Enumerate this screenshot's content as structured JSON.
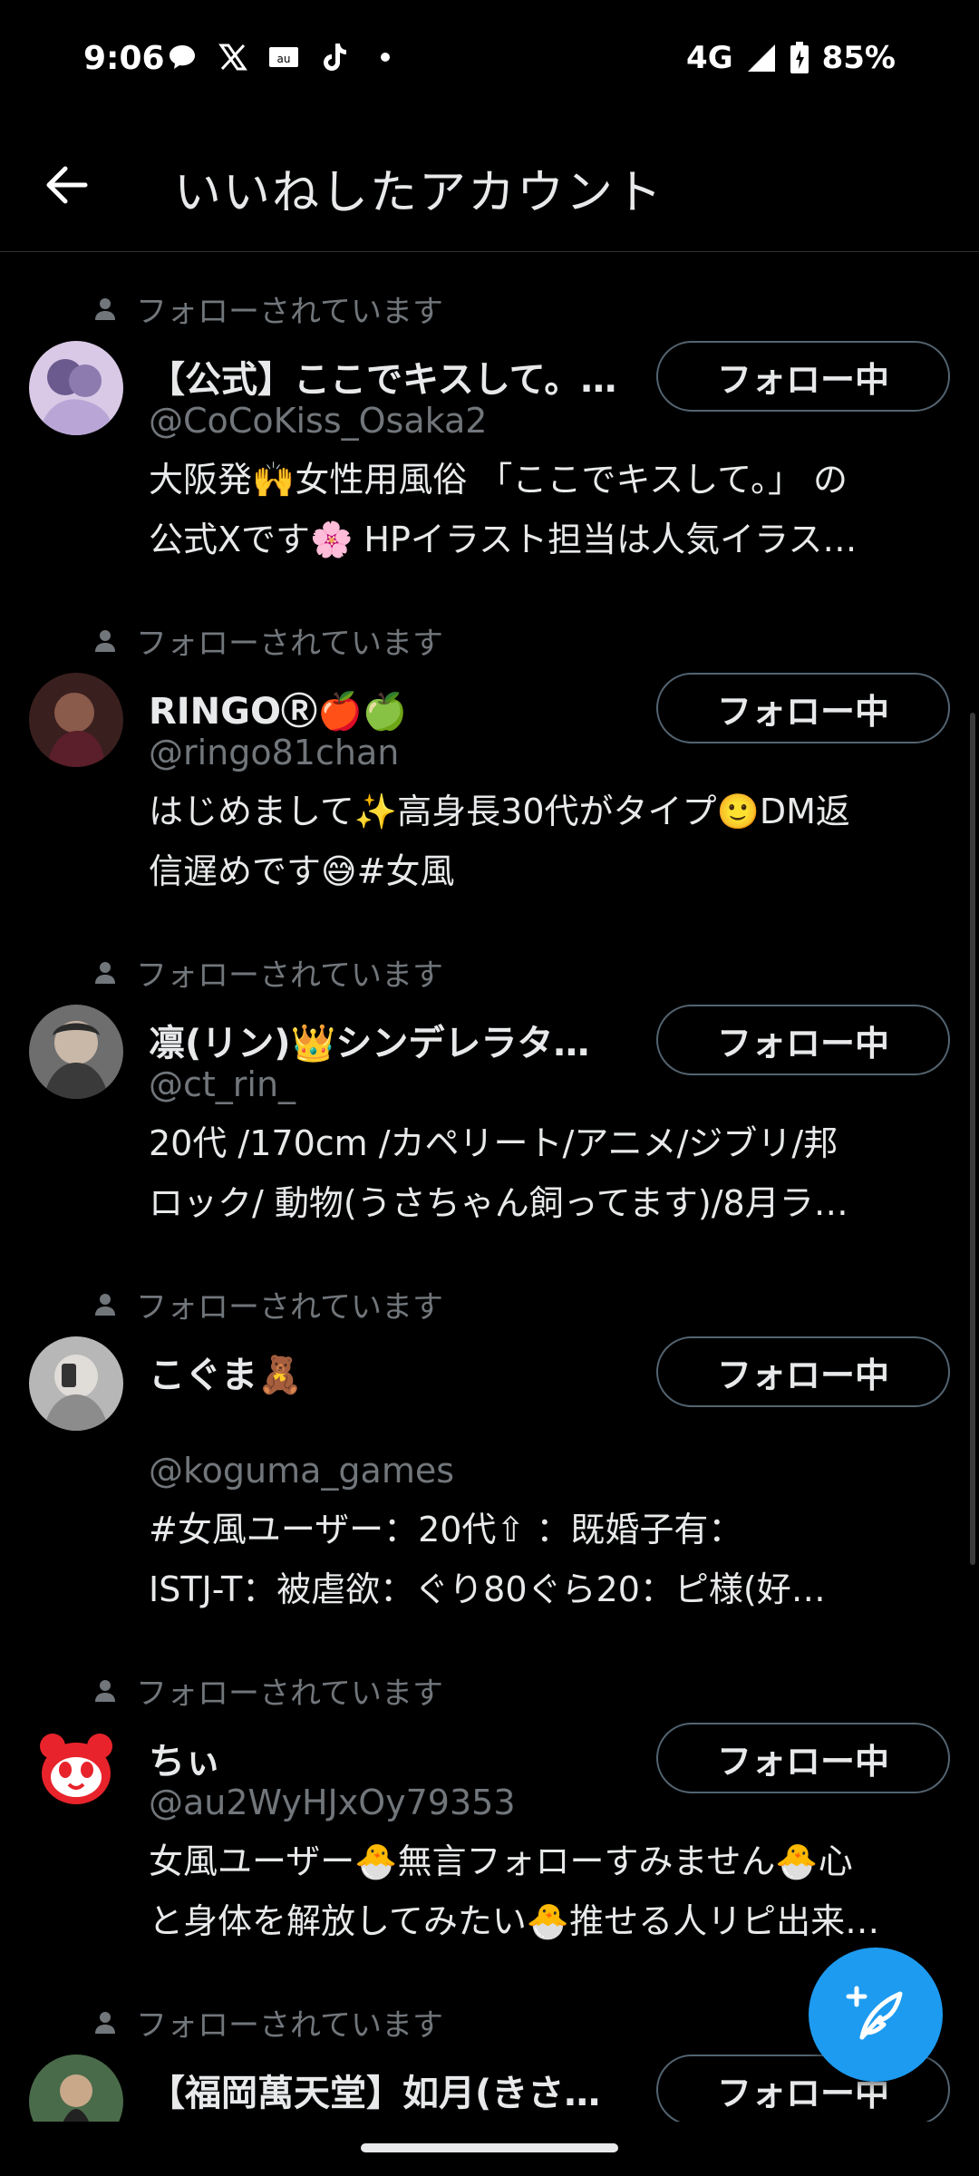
{
  "status_bar": {
    "time": "9:06",
    "network": "4G",
    "battery": "85%",
    "icons": [
      "chat-icon",
      "x-logo-icon",
      "au-mail-icon",
      "tiktok-icon",
      "dot-icon"
    ]
  },
  "header": {
    "title": "いいねしたアカウント"
  },
  "colors": {
    "background": "#000000",
    "text_primary": "#e7e9ea",
    "text_secondary": "#71767b",
    "accent": "#1d9bf0",
    "button_border": "#536471"
  },
  "users": [
    {
      "followed_label": "フォローされています",
      "name": "【公式】ここでキスして。…",
      "handle": "@CoCoKiss_Osaka2",
      "bio_lines": [
        "大阪発🙌女性用風俗 「ここでキスして。」 の",
        "公式Xです🌸 HPイラスト担当は人気イラス…"
      ],
      "button": "フォロー中"
    },
    {
      "followed_label": "フォローされています",
      "name": "RINGOⓇ🍎🍏",
      "handle": "@ringo81chan",
      "bio_lines": [
        "はじめまして✨高身長30代がタイプ🙂DM返",
        "信遅めです😅#女風"
      ],
      "button": "フォロー中"
    },
    {
      "followed_label": "フォローされています",
      "name": "凛(リン)👑シンデレラタ…",
      "handle": "@ct_rin_",
      "bio_lines": [
        "20代 /170cm /カペリート/アニメ/ジブリ/邦",
        "ロック/ 動物(うさちゃん飼ってます)/8月ラ…"
      ],
      "button": "フォロー中"
    },
    {
      "followed_label": "フォローされています",
      "name": "こぐま🧸",
      "handle": "@koguma_games",
      "bio_lines": [
        "#女風ユーザー：20代⇧ ：既婚子有：",
        "ISTJ‐T：被虐欲：ぐり80ぐら20：ピ様(好…"
      ],
      "button": "フォロー中"
    },
    {
      "followed_label": "フォローされています",
      "name": "ちぃ",
      "handle": "@au2WyHJxOy79353",
      "bio_lines": [
        "女風ユーザー🐣無言フォローすみません🐣心",
        "と身体を解放してみたい🐣推せる人リピ出来…"
      ],
      "button": "フォロー中"
    },
    {
      "followed_label": "フォローされています",
      "name": "【福岡萬天堂】如月(きさ…",
      "handle": "",
      "bio_lines": [],
      "button": "フォロー中"
    }
  ]
}
